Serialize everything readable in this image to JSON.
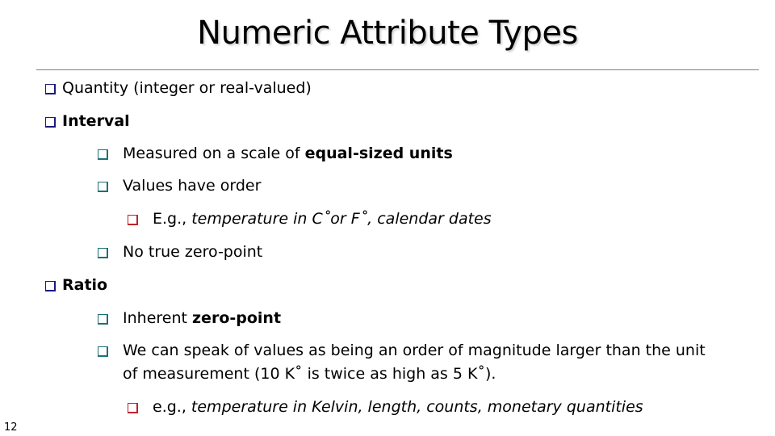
{
  "slide": {
    "title": "Numeric Attribute Types",
    "page_number": "12"
  },
  "bullets": {
    "quantity": {
      "label": "Quantity (integer or real-valued)"
    },
    "interval": {
      "label": "Interval",
      "items": [
        {
          "prefix": "Measured on a scale of ",
          "bold": "equal-sized units"
        },
        {
          "text": "Values have order"
        },
        {
          "prefix": "E.g., ",
          "italic": "temperature in C˚or F˚, calendar dates"
        },
        {
          "text": "No true zero-point"
        }
      ]
    },
    "ratio": {
      "label": "Ratio",
      "items": [
        {
          "prefix": "Inherent ",
          "bold": "zero-point"
        },
        {
          "text": "We can speak of values as being an order of magnitude larger than the unit of measurement (10 K˚ is twice as high as 5 K˚)."
        },
        {
          "prefix": "e.g., ",
          "italic": "temperature in Kelvin, length, counts, monetary quantities"
        }
      ]
    }
  },
  "colors": {
    "level1_bullet": "#1a1a80",
    "level2_bullet": "#1f6f78",
    "level3_bullet": "#c0222b",
    "divider": "#808080"
  }
}
